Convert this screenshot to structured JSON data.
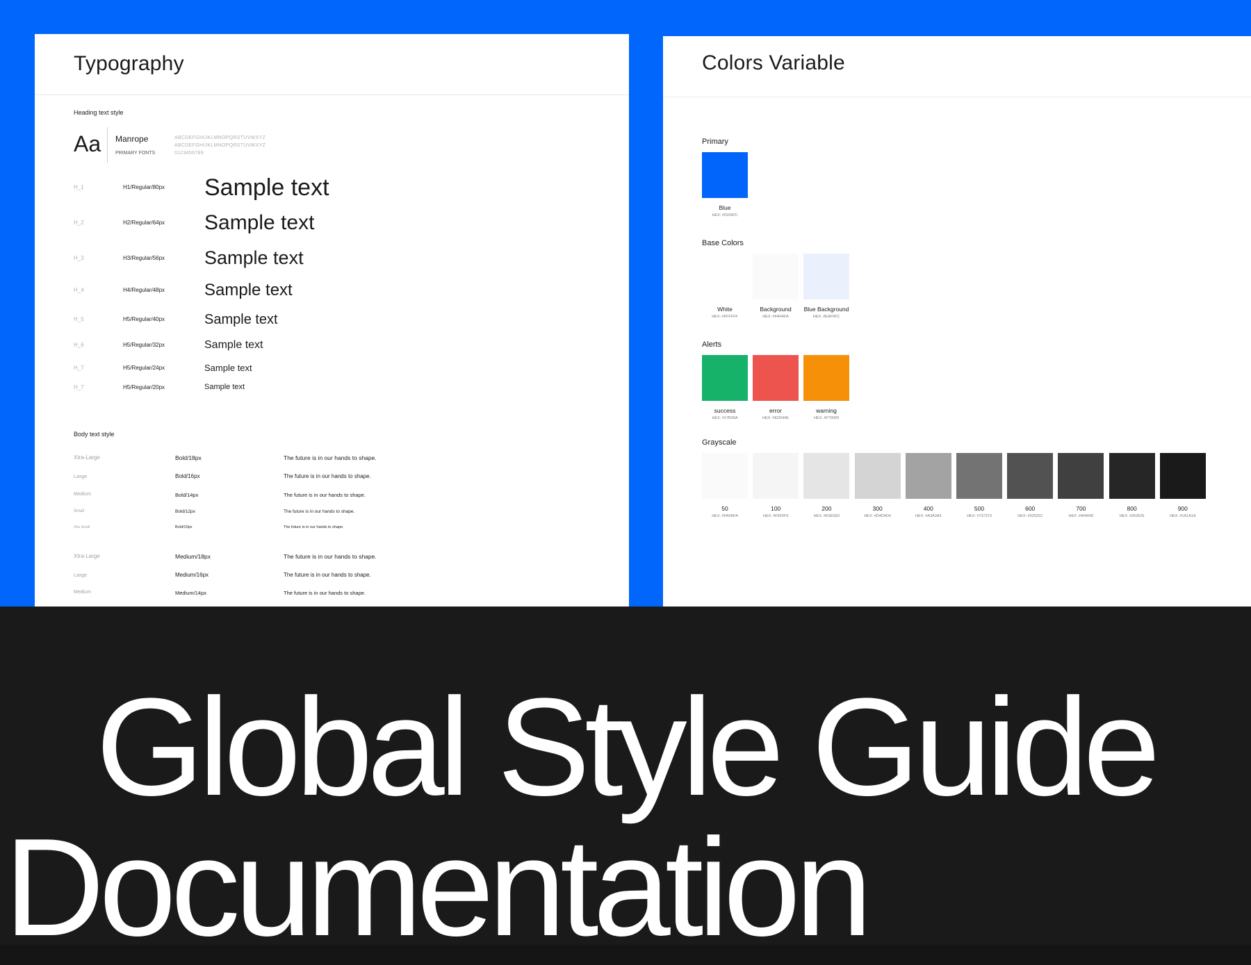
{
  "typography": {
    "title": "Typography",
    "heading_section": "Heading text style",
    "specimen": "Aa",
    "font_name": "Manrope",
    "font_role": "PRIMARY FONTS",
    "alphabet_upper": "ABCDEFGHIJKLMNOPQRSTUVWXYZ",
    "alphabet_upper2": "ABCDEFGHIJKLMNOPQRSTUVWXYZ",
    "digits": "0123456789",
    "headings": [
      {
        "tag": "H_1",
        "spec": "H1/Regular/80px",
        "sample": "Sample text"
      },
      {
        "tag": "H_2",
        "spec": "H2/Regular/64px",
        "sample": "Sample text"
      },
      {
        "tag": "H_3",
        "spec": "H3/Regular/56px",
        "sample": "Sample text"
      },
      {
        "tag": "H_4",
        "spec": "H4/Regular/48px",
        "sample": "Sample text"
      },
      {
        "tag": "H_5",
        "spec": "H5/Regular/40px",
        "sample": "Sample text"
      },
      {
        "tag": "H_6",
        "spec": "H5/Regular/32px",
        "sample": "Sample text"
      },
      {
        "tag": "H_7",
        "spec": "H5/Regular/24px",
        "sample": "Sample text"
      },
      {
        "tag": "H_7",
        "spec": "H5/Regular/20px",
        "sample": "Sample text"
      }
    ],
    "body_section": "Body text style",
    "body_rows": [
      {
        "size": "Xtra-Large",
        "weight": "Bold/18px",
        "sample": "The future is in our hands to shape."
      },
      {
        "size": "Large",
        "weight": "Bold/16px",
        "sample": "The future is in our hands to shape."
      },
      {
        "size": "Medium",
        "weight": "Bold/14px",
        "sample": "The future is in our hands to shape."
      },
      {
        "size": "Small",
        "weight": "Bold/12px",
        "sample": "The future is in our hands to shape."
      },
      {
        "size": "Xtra Small",
        "weight": "Bold/10px",
        "sample": "The future is in our hands to shape."
      },
      {
        "size": "Xtra-Large",
        "weight": "Medium/18px",
        "sample": "The future is in our hands to shape."
      },
      {
        "size": "Large",
        "weight": "Medium/16px",
        "sample": "The future is in our hands to shape."
      },
      {
        "size": "Medium",
        "weight": "Medium/14px",
        "sample": "The future is in our hands to shape."
      }
    ]
  },
  "colors": {
    "title": "Colors Variable",
    "primary_label": "Primary",
    "primary": [
      {
        "name": "Blue",
        "hex": "HEX: #0165FC",
        "color": "#0165FC"
      }
    ],
    "base_label": "Base Colors",
    "base": [
      {
        "name": "White",
        "hex": "HEX: #FFFFFF",
        "color": "#FFFFFF"
      },
      {
        "name": "Background",
        "hex": "HEX: #FAFAFA",
        "color": "#FAFAFA"
      },
      {
        "name": "Blue Background",
        "hex": "HEX: #EAF0FC",
        "color": "#EAF0FC"
      }
    ],
    "alerts_label": "Alerts",
    "alerts": [
      {
        "name": "success",
        "hex": "HEX: #17B26A",
        "color": "#17B26A"
      },
      {
        "name": "error",
        "hex": "HEX: #ED544E",
        "color": "#ED544E"
      },
      {
        "name": "warning",
        "hex": "HEX: #F79009",
        "color": "#F79009"
      }
    ],
    "grayscale_label": "Grayscale",
    "grayscale": [
      {
        "name": "50",
        "hex": "HEX: #FAFAFA",
        "color": "#FAFAFA"
      },
      {
        "name": "100",
        "hex": "HEX: #F5F5F5",
        "color": "#F5F5F5"
      },
      {
        "name": "200",
        "hex": "HEX: #E5E5E5",
        "color": "#E5E5E5"
      },
      {
        "name": "300",
        "hex": "HEX: #D4D4D4",
        "color": "#D4D4D4"
      },
      {
        "name": "400",
        "hex": "HEX: #A3A3A3",
        "color": "#A3A3A3"
      },
      {
        "name": "500",
        "hex": "HEX: #737373",
        "color": "#737373"
      },
      {
        "name": "600",
        "hex": "HEX: #525252",
        "color": "#525252"
      },
      {
        "name": "700",
        "hex": "HEX: #404040",
        "color": "#404040"
      },
      {
        "name": "800",
        "hex": "HEX: #262626",
        "color": "#262626"
      },
      {
        "name": "900",
        "hex": "HEX: #1A1A1A",
        "color": "#1A1A1A"
      }
    ]
  },
  "hero": {
    "line1": "Global Style Guide",
    "line2": "Documentation"
  },
  "theme": {
    "accent": "#0066FC",
    "dark": "#1A1A1A"
  }
}
